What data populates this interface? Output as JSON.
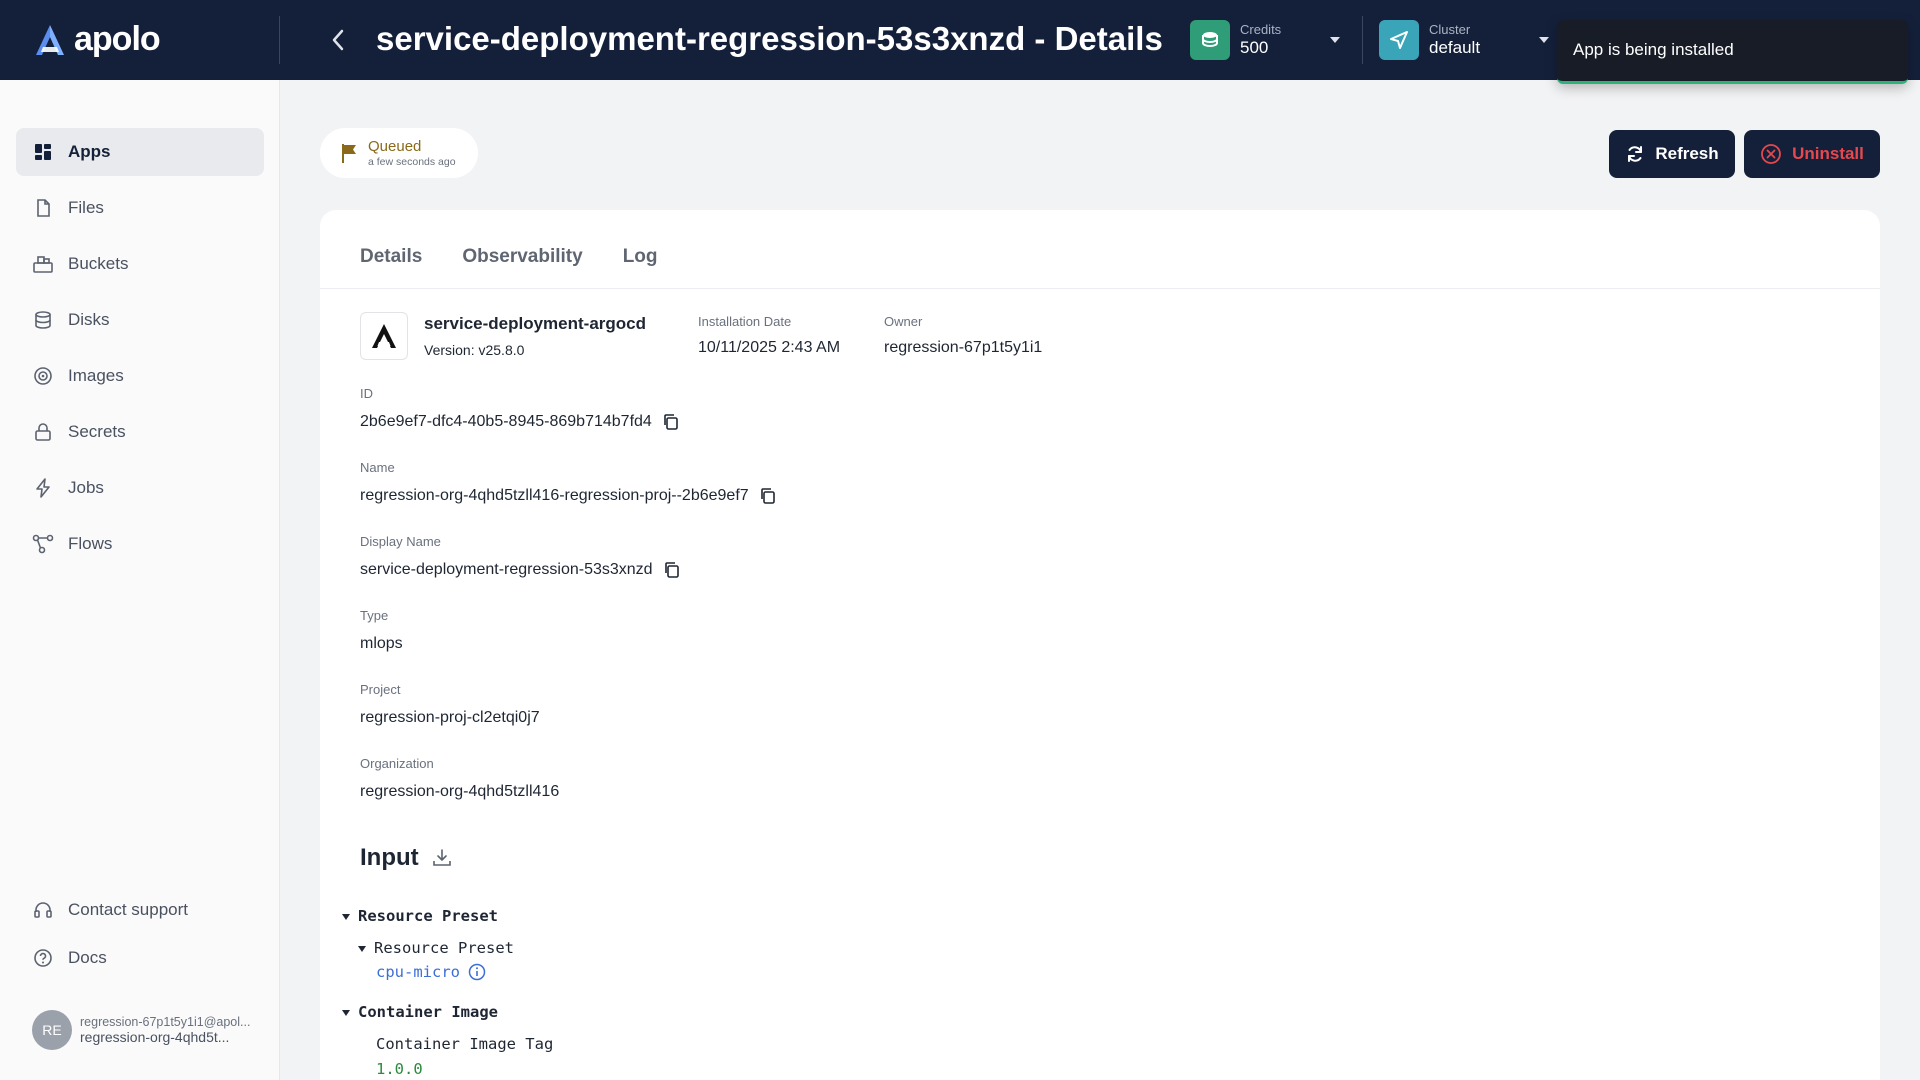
{
  "header": {
    "logo_text": "apolo",
    "title": "service-deployment-regression-53s3xnzd - Details",
    "credits": {
      "label": "Credits",
      "value": "500"
    },
    "cluster": {
      "label": "Cluster",
      "value": "default"
    }
  },
  "toast": {
    "message": "App is being installed"
  },
  "sidebar": {
    "items": [
      {
        "label": "Apps",
        "icon": "apps-icon"
      },
      {
        "label": "Files",
        "icon": "file-icon"
      },
      {
        "label": "Buckets",
        "icon": "bucket-icon"
      },
      {
        "label": "Disks",
        "icon": "disk-icon"
      },
      {
        "label": "Images",
        "icon": "image-icon"
      },
      {
        "label": "Secrets",
        "icon": "lock-icon"
      },
      {
        "label": "Jobs",
        "icon": "bolt-icon"
      },
      {
        "label": "Flows",
        "icon": "flow-icon"
      }
    ],
    "support": "Contact support",
    "docs": "Docs",
    "user": {
      "initials": "RE",
      "email": "regression-67p1t5y1i1@apol...",
      "org": "regression-org-4qhd5t..."
    }
  },
  "status": {
    "label": "Queued",
    "time": "a few seconds ago",
    "color": "#8a6a1a"
  },
  "actions": {
    "refresh": "Refresh",
    "uninstall": "Uninstall"
  },
  "tabs": [
    "Details",
    "Observability",
    "Log"
  ],
  "app": {
    "name": "service-deployment-argocd",
    "version": "Version: v25.8.0",
    "installation_date_label": "Installation Date",
    "installation_date": "10/11/2025 2:43 AM",
    "owner_label": "Owner",
    "owner": "regression-67p1t5y1i1"
  },
  "fields": {
    "id": {
      "label": "ID",
      "value": "2b6e9ef7-dfc4-40b5-8945-869b714b7fd4"
    },
    "name": {
      "label": "Name",
      "value": "regression-org-4qhd5tzll416-regression-proj--2b6e9ef7"
    },
    "display_name": {
      "label": "Display Name",
      "value": "service-deployment-regression-53s3xnzd"
    },
    "type": {
      "label": "Type",
      "value": "mlops"
    },
    "project": {
      "label": "Project",
      "value": "regression-proj-cl2etqi0j7"
    },
    "organization": {
      "label": "Organization",
      "value": "regression-org-4qhd5tzll416"
    }
  },
  "input": {
    "title": "Input",
    "resource_preset_group": "Resource Preset",
    "resource_preset_key": "Resource Preset",
    "resource_preset_value": "cpu-micro",
    "container_image_group": "Container Image",
    "container_image_tag_key": "Container Image Tag",
    "container_image_tag_value": "1.0.0"
  },
  "colors": {
    "header_bg": "#14203a",
    "accent_green": "#2fb27a",
    "danger": "#e5484d"
  }
}
